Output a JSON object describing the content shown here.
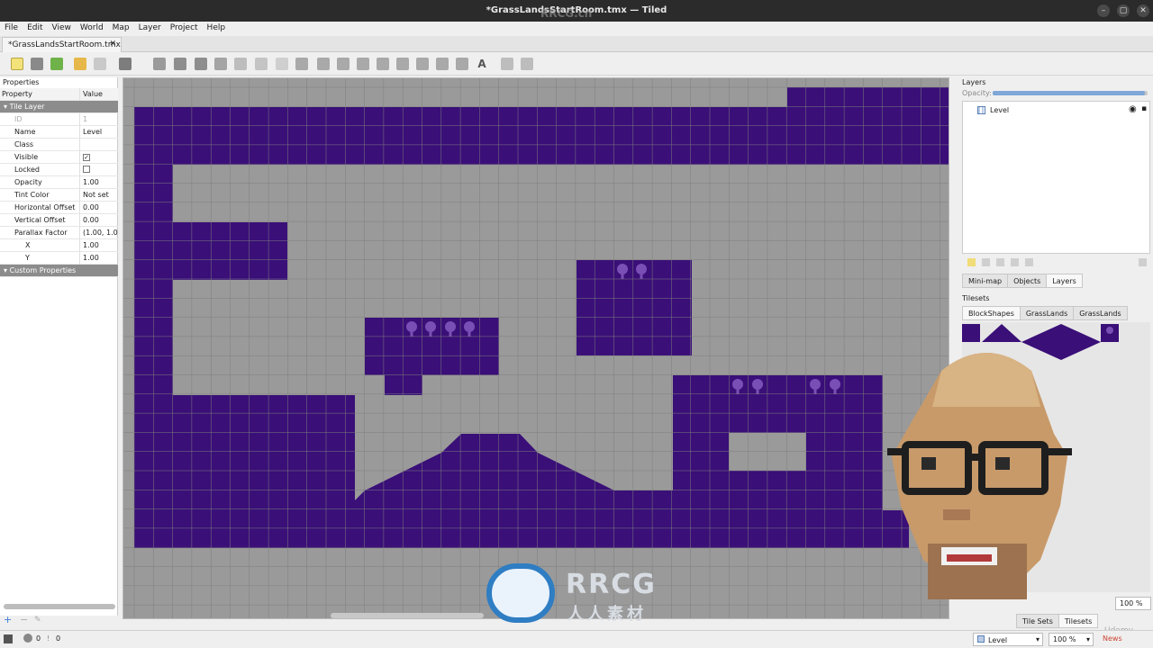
{
  "window": {
    "title": "*GrassLandsStartRoom.tmx — Tiled",
    "minimize": "–",
    "maximize": "▢",
    "close": "✕"
  },
  "menu": [
    "File",
    "Edit",
    "View",
    "World",
    "Map",
    "Layer",
    "Project",
    "Help"
  ],
  "document_tab": {
    "label": "*GrassLandsStartRoom.tmx",
    "close": "✕"
  },
  "properties": {
    "panel_title": "Properties",
    "col_property": "Property",
    "col_value": "Value",
    "group_tile_layer": "Tile Layer",
    "rows": [
      {
        "k": "ID",
        "v": "1"
      },
      {
        "k": "Name",
        "v": "Level"
      },
      {
        "k": "Class",
        "v": ""
      },
      {
        "k": "Visible",
        "v": "✓"
      },
      {
        "k": "Locked",
        "v": ""
      },
      {
        "k": "Opacity",
        "v": "1.00"
      },
      {
        "k": "Tint Color",
        "v": "Not set"
      },
      {
        "k": "Horizontal Offset",
        "v": "0.00"
      },
      {
        "k": "Vertical Offset",
        "v": "0.00"
      },
      {
        "k": "Parallax Factor",
        "v": "(1.00, 1.00)"
      },
      {
        "k": "X",
        "v": "1.00"
      },
      {
        "k": "Y",
        "v": "1.00"
      }
    ],
    "group_custom": "Custom Properties"
  },
  "layers_panel": {
    "title": "Layers",
    "opacity_label": "Opacity:",
    "opacity_value": 0.98,
    "layer_name": "Level"
  },
  "tabs_lower": [
    "Mini-map",
    "Objects",
    "Layers"
  ],
  "tilesets_panel": {
    "title": "Tilesets",
    "tabs": [
      "BlockShapes",
      "GrassLands",
      "GrassLands"
    ],
    "zoom": "100 %"
  },
  "bottom_tabs": [
    "Tile Sets",
    "Tilesets"
  ],
  "status": {
    "errors": "0",
    "warnings": "0",
    "layer": "Level",
    "zoom": "100 %",
    "news": "News"
  },
  "colors": {
    "tile": "#3a0f78",
    "tile_decor": "#7a4fb5",
    "empty": "#9a9a9a",
    "grid": "#7e7e7e"
  },
  "watermark": {
    "brand": "RRCG",
    "cn": "人人素材",
    "overlay": "RRCG.cn",
    "corner": "Udemy"
  }
}
